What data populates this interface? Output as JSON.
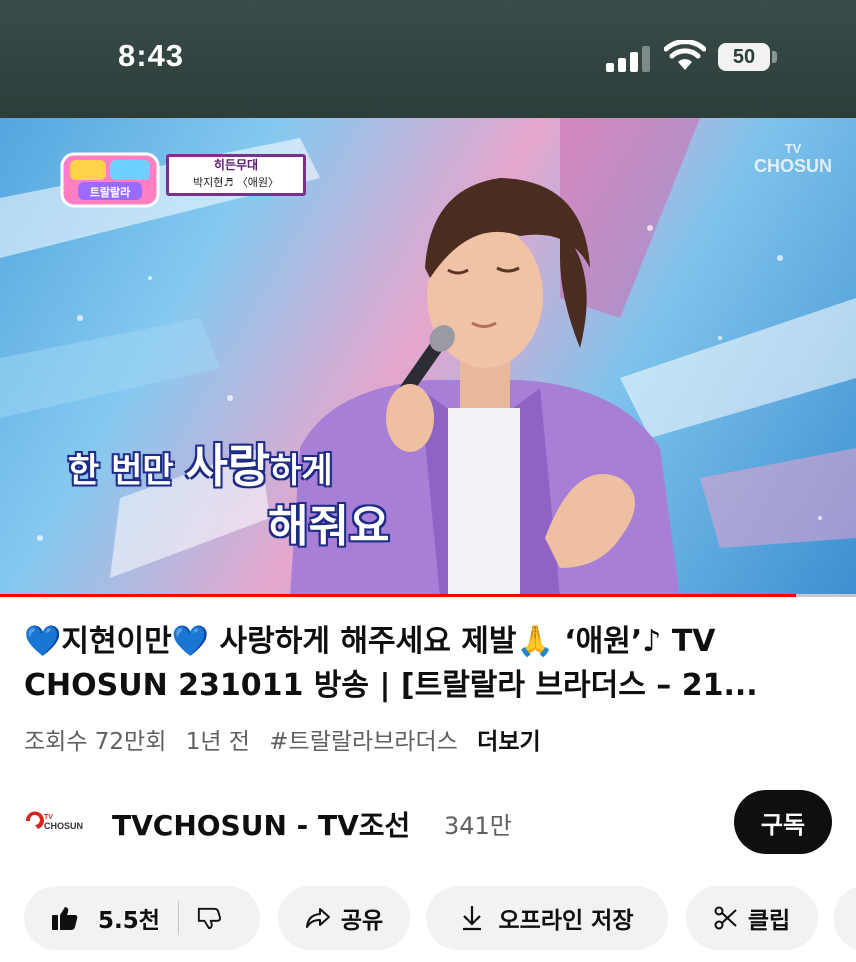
{
  "status_bar": {
    "time": "8:43",
    "battery": "50",
    "background_color": "#2c3d3a"
  },
  "video": {
    "show_logo_text": "트랄랄라 브라더스",
    "caption_title": "히든무대",
    "caption_song": "박지현♬ 〈애원〉",
    "channel_watermark_top": "TV",
    "channel_watermark_bottom": "CHOSUN",
    "lyric_line1_a": "한 번만 ",
    "lyric_line1_b": "사랑",
    "lyric_line1_c": "하게",
    "lyric_line2": "해줘요",
    "progress_fraction": 0.93,
    "progress_color": "#ff0000"
  },
  "title": {
    "line1": "💙지현이만💙 사랑하게 해주세요 제발🙏 ‘애원’♪ TV",
    "line2": "CHOSUN 231011 방송 | [트랄랄라 브라더스 – 21..."
  },
  "meta": {
    "views": "조회수 72만회",
    "age": "1년 전",
    "hashtag": "#트랄랄라브라더스",
    "more": "더보기"
  },
  "channel": {
    "logo_small": "TV",
    "logo_text": "CHOSUN",
    "name": "TVCHOSUN - TV조선",
    "subscribers": "341만",
    "subscribe_label": "구독"
  },
  "actions": {
    "like_count": "5.5천",
    "share_label": "공유",
    "save_label": "오프라인 저장",
    "clip_label": "클립"
  },
  "icons": {
    "like": "thumbs-up-icon",
    "dislike": "thumbs-down-icon",
    "share": "share-arrow-icon",
    "save": "download-icon",
    "clip": "scissors-icon"
  }
}
